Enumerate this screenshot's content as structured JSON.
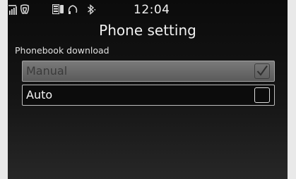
{
  "status_bar": {
    "time": "12:04",
    "icons": [
      "signal-strength-icon",
      "phone-icon",
      "phonebook-icon",
      "headset-icon",
      "bluetooth-icon"
    ]
  },
  "screen_title": "Phone setting",
  "phonebook_download": {
    "label": "Phonebook download",
    "options": [
      {
        "label": "Manual",
        "checked": true,
        "highlighted": true
      },
      {
        "label": "Auto",
        "checked": false,
        "highlighted": false
      }
    ]
  },
  "colors": {
    "background": "#151515",
    "highlight": "#6a6a6a",
    "text": "#ececec"
  }
}
